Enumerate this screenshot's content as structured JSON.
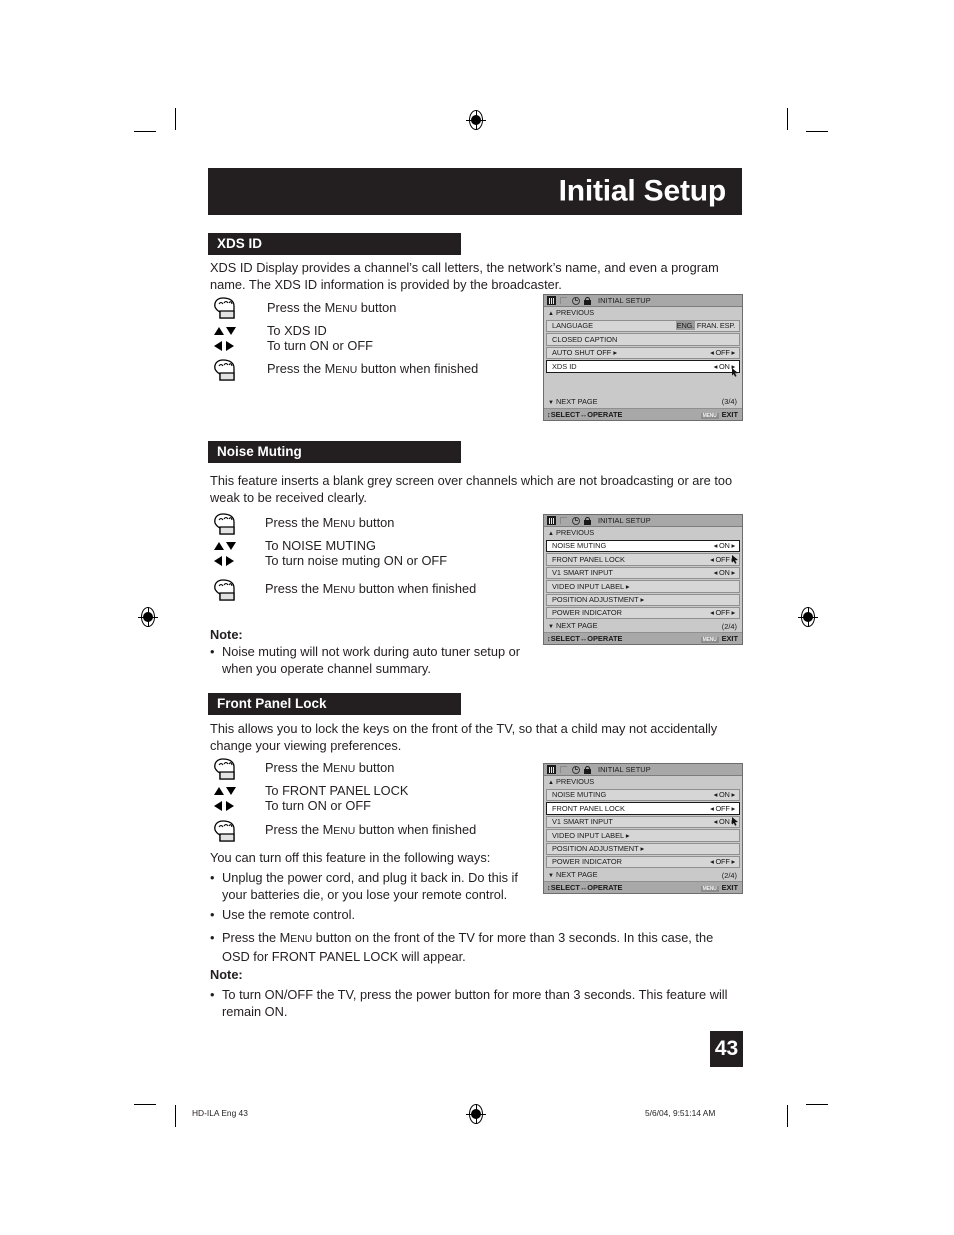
{
  "page": {
    "title": "Initial Setup",
    "page_number": "43",
    "printer_left": "HD-ILA Eng   43",
    "printer_right": "5/6/04, 9:51:14 AM"
  },
  "sections": [
    {
      "heading": "XDS ID",
      "body": "XDS ID Display provides a channel’s call letters, the network’s name, and even a program name. The XDS ID information is provided by the broadcaster.",
      "steps": [
        {
          "icon": "hand-press-icon",
          "text_pre": "Press the M",
          "text_sc": "ENU",
          "text_post": " button"
        },
        {
          "icon": "arrows-up-down-icon",
          "text_pre": "To XDS ID",
          "text_sc": "",
          "text_post": ""
        },
        {
          "icon": "arrows-left-right-icon",
          "text_pre": "To turn ON or OFF",
          "text_sc": "",
          "text_post": ""
        },
        {
          "icon": "hand-press-icon",
          "text_pre": "Press the M",
          "text_sc": "ENU",
          "text_post": " button when finished"
        }
      ]
    },
    {
      "heading": "Noise Muting",
      "body": "This feature inserts a blank grey screen over channels which are not broadcasting or are too weak to be received clearly.",
      "steps": [
        {
          "icon": "hand-press-icon",
          "text_pre": "Press the M",
          "text_sc": "ENU",
          "text_post": " button"
        },
        {
          "icon": "arrows-up-down-icon",
          "text_pre": "To NOISE MUTING",
          "text_sc": "",
          "text_post": ""
        },
        {
          "icon": "arrows-left-right-icon",
          "text_pre": "To turn noise muting ON or OFF",
          "text_sc": "",
          "text_post": ""
        },
        {
          "icon": "hand-press-icon",
          "text_pre": "Press the M",
          "text_sc": "ENU",
          "text_post": " button when finished"
        }
      ],
      "note_label": "Note:",
      "note_bullets": [
        "Noise muting will not work during auto tuner setup or when you operate channel summary."
      ]
    },
    {
      "heading": "Front Panel Lock",
      "body": "This allows you to lock the keys on the front of the TV, so that a child may not accidentally change your viewing preferences.",
      "steps": [
        {
          "icon": "hand-press-icon",
          "text_pre": "Press the M",
          "text_sc": "ENU",
          "text_post": " button"
        },
        {
          "icon": "arrows-up-down-icon",
          "text_pre": "To FRONT PANEL LOCK",
          "text_sc": "",
          "text_post": ""
        },
        {
          "icon": "arrows-left-right-icon",
          "text_pre": "To turn ON or OFF",
          "text_sc": "",
          "text_post": ""
        },
        {
          "icon": "hand-press-icon",
          "text_pre": "Press the M",
          "text_sc": "ENU",
          "text_post": " button when finished"
        }
      ],
      "lead_in": "You can turn off this feature in the following ways:",
      "ways_bullets": [
        "Unplug the power cord, and plug it back in. Do this if your batteries die, or you lose your remote control.",
        "Use the remote control.",
        "Press the MENU button on the front of the TV for more than 3 seconds. In this case, the OSD for FRONT PANEL LOCK will appear."
      ],
      "note_label": "Note:",
      "note_bullets": [
        "To turn ON/OFF the TV, press the power button for more than 3 seconds. This feature will remain ON."
      ]
    }
  ],
  "osd": {
    "icons": [
      "picture-bars-icon",
      "flag-icon",
      "clock-icon",
      "lock-icon"
    ],
    "title": "INITIAL SETUP",
    "previous_label": "PREVIOUS",
    "next_page_label": "NEXT PAGE",
    "footer_select": "SELECT",
    "footer_operate": "OPERATE",
    "footer_menu_key": "MENU",
    "footer_exit": "EXIT",
    "panels": [
      {
        "name": "xds-id-osd",
        "page_indicator": "(3/4)",
        "rows": [
          {
            "label": "LANGUAGE",
            "value": "ENG. FRAN. ESP.",
            "value_kind": "language",
            "selected": false
          },
          {
            "label": "CLOSED CAPTION",
            "value": "",
            "value_kind": "none",
            "selected": false
          },
          {
            "label": "AUTO SHUT OFF ▸",
            "value": "◂ OFF ▸",
            "value_kind": "toggle",
            "selected": false
          },
          {
            "label": "XDS ID",
            "value": "◂ ON ▸",
            "value_kind": "toggle",
            "selected": true
          }
        ],
        "blank_rows": 2
      },
      {
        "name": "noise-muting-osd",
        "page_indicator": "(2/4)",
        "rows": [
          {
            "label": "NOISE MUTING",
            "value": "◂ ON ▸",
            "value_kind": "toggle",
            "selected": true
          },
          {
            "label": "FRONT PANEL LOCK",
            "value": "◂ OFF ▸",
            "value_kind": "toggle",
            "selected": false
          },
          {
            "label": "V1 SMART INPUT",
            "value": "◂ ON ▸",
            "value_kind": "toggle",
            "selected": false
          },
          {
            "label": "VIDEO INPUT LABEL ▸",
            "value": "",
            "value_kind": "none",
            "selected": false
          },
          {
            "label": "POSITION ADJUSTMENT ▸",
            "value": "",
            "value_kind": "none",
            "selected": false
          },
          {
            "label": "POWER INDICATOR",
            "value": "◂ OFF ▸",
            "value_kind": "toggle",
            "selected": false
          }
        ],
        "blank_rows": 0
      },
      {
        "name": "front-panel-lock-osd",
        "page_indicator": "(2/4)",
        "rows": [
          {
            "label": "NOISE MUTING",
            "value": "◂ ON ▸",
            "value_kind": "toggle",
            "selected": false
          },
          {
            "label": "FRONT PANEL LOCK",
            "value": "◂ OFF ▸",
            "value_kind": "toggle",
            "selected": true
          },
          {
            "label": "V1 SMART INPUT",
            "value": "◂ ON ▸",
            "value_kind": "toggle",
            "selected": false
          },
          {
            "label": "VIDEO INPUT LABEL ▸",
            "value": "",
            "value_kind": "none",
            "selected": false
          },
          {
            "label": "POSITION ADJUSTMENT ▸",
            "value": "",
            "value_kind": "none",
            "selected": false
          },
          {
            "label": "POWER INDICATOR",
            "value": "◂ OFF ▸",
            "value_kind": "toggle",
            "selected": false
          }
        ],
        "blank_rows": 0
      }
    ]
  }
}
